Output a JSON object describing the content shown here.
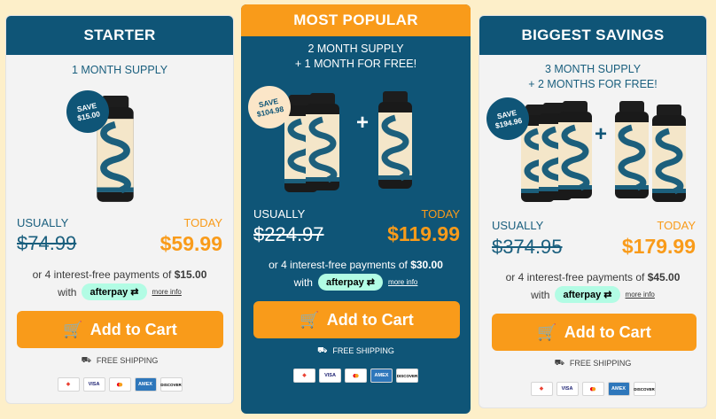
{
  "colors": {
    "brand": "#0f5577",
    "accent": "#f99b1a",
    "page_bg": "#fdefc9",
    "afterpay": "#b2fce4"
  },
  "cards": [
    {
      "header": "STARTER",
      "supply_line1": "1 MONTH SUPPLY",
      "supply_line2": "",
      "save_label": "SAVE",
      "save_amount": "$15.00",
      "usually_label": "USUALLY",
      "today_label": "TODAY",
      "old_price": "$74.99",
      "new_price": "$59.99",
      "installments_text": "or 4 interest-free payments of",
      "installment_amount": "$15.00",
      "with_label": "with",
      "afterpay_label": "afterpay",
      "more_info": "more info",
      "cart_label": "Add to Cart",
      "shipping_label": "FREE SHIPPING"
    },
    {
      "top_header": "MOST POPULAR",
      "supply_line1": "2 MONTH SUPPLY",
      "supply_line2": "+ 1 MONTH FOR FREE!",
      "save_label": "SAVE",
      "save_amount": "$104.98",
      "usually_label": "USUALLY",
      "today_label": "TODAY",
      "old_price": "$224.97",
      "new_price": "$119.99",
      "installments_text": "or 4 interest-free payments of",
      "installment_amount": "$30.00",
      "with_label": "with",
      "afterpay_label": "afterpay",
      "more_info": "more info",
      "cart_label": "Add to Cart",
      "shipping_label": "FREE SHIPPING"
    },
    {
      "header": "BIGGEST SAVINGS",
      "supply_line1": "3 MONTH SUPPLY",
      "supply_line2": "+ 2 MONTHS FOR FREE!",
      "save_label": "SAVE",
      "save_amount": "$194.96",
      "usually_label": "USUALLY",
      "today_label": "TODAY",
      "old_price": "$374.95",
      "new_price": "$179.99",
      "installments_text": "or 4 interest-free payments of",
      "installment_amount": "$45.00",
      "with_label": "with",
      "afterpay_label": "afterpay",
      "more_info": "more info",
      "cart_label": "Add to Cart",
      "shipping_label": "FREE SHIPPING"
    }
  ],
  "payment_methods": [
    "VISA",
    "AMEX",
    "DISCOVER"
  ],
  "icons": [
    "cart-icon",
    "truck-icon",
    "afterpay-arrow-icon",
    "google-pay-icon",
    "mastercard-icon"
  ]
}
